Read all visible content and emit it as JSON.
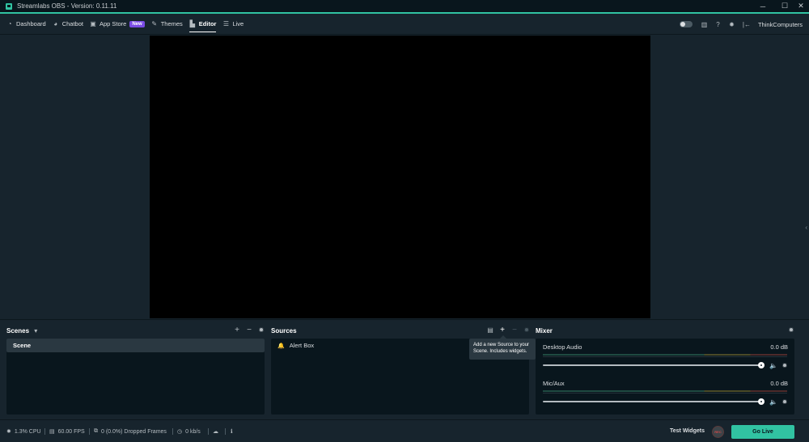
{
  "window": {
    "title": "Streamlabs OBS - Version: 0.11.11",
    "controls": {
      "minimize": "─",
      "maximize": "☐",
      "close": "✕"
    }
  },
  "nav": {
    "items": [
      {
        "label": "Dashboard",
        "icon": "dashboard-icon",
        "glyph": "◔"
      },
      {
        "label": "Chatbot",
        "icon": "chatbot-icon",
        "glyph": "◕"
      },
      {
        "label": "App Store",
        "icon": "app-store-icon",
        "glyph": "▣",
        "badge": "New"
      },
      {
        "label": "Themes",
        "icon": "themes-icon",
        "glyph": "✎"
      },
      {
        "label": "Editor",
        "icon": "editor-icon",
        "glyph": "▙",
        "active": true
      },
      {
        "label": "Live",
        "icon": "live-icon",
        "glyph": "☰"
      }
    ],
    "right": {
      "icons": {
        "studio": "▥",
        "help": "?",
        "settings": "✹",
        "logout": "|←"
      },
      "user": "ThinkComputers"
    }
  },
  "side_chevron": "‹",
  "scenes": {
    "title": "Scenes",
    "dropdown": "▾",
    "add": "+",
    "remove": "−",
    "settings": "✹",
    "items": [
      "Scene"
    ]
  },
  "sources": {
    "title": "Sources",
    "folder": "▤",
    "add": "+",
    "remove": "−",
    "settings": "✹",
    "items": [
      {
        "label": "Alert Box",
        "glyph": "🔔"
      }
    ],
    "tooltip": "Add a new Source to your Scene. Includes widgets."
  },
  "mixer": {
    "title": "Mixer",
    "settings": "✹",
    "channels": [
      {
        "name": "Desktop Audio",
        "db": "0.0 dB",
        "volume": 1.0
      },
      {
        "name": "Mic/Aux",
        "db": "0.0 dB",
        "volume": 1.0
      }
    ],
    "mute_glyph": "🔈",
    "gear_glyph": "✹"
  },
  "footer": {
    "cpu": "1.3% CPU",
    "fps": "60.00 FPS",
    "dropped": "0 (0.0%) Dropped Frames",
    "bitrate": "0 kb/s",
    "glyphs": {
      "cpu": "✹",
      "fps": "▤",
      "dropped": "⧉",
      "bitrate": "◷",
      "cloud": "☁",
      "info": "ℹ"
    },
    "test_widgets": "Test Widgets",
    "rec": "REC",
    "go_live": "Go Live"
  },
  "colors": {
    "accent": "#31c3a2",
    "background": "#17242d",
    "panel": "#09161d",
    "badge_new": "#7a4ce5"
  }
}
